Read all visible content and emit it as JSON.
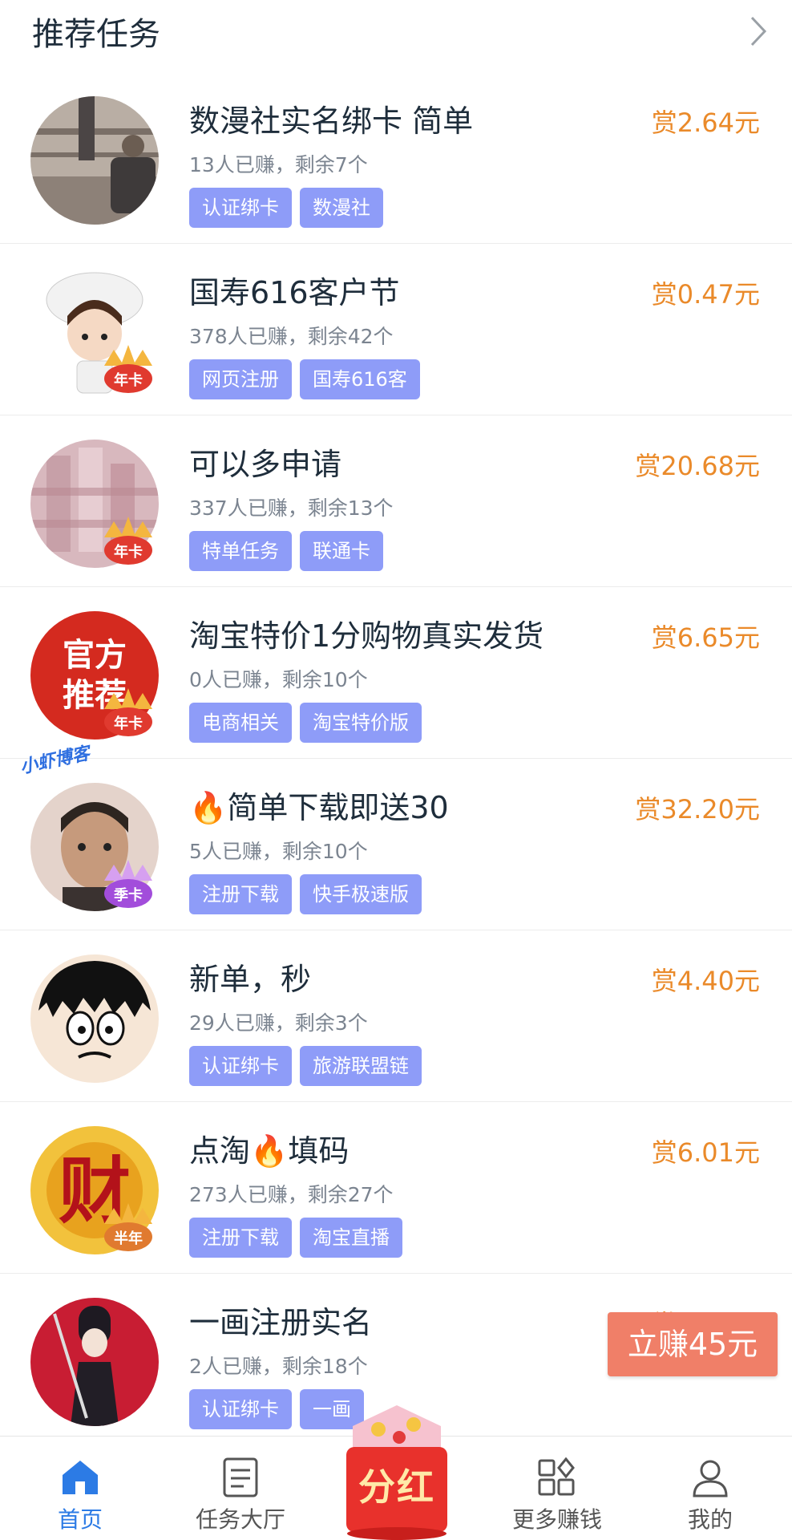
{
  "header": {
    "title": "推荐任务"
  },
  "tasks": [
    {
      "title": "数漫社实名绑卡 简单",
      "stats": "13人已赚，剩余7个",
      "tags": [
        "认证绑卡",
        "数漫社"
      ],
      "reward": "赏2.64元",
      "badge": ""
    },
    {
      "title": "国寿616客户节",
      "stats": "378人已赚，剩余42个",
      "tags": [
        "网页注册",
        "国寿616客"
      ],
      "reward": "赏0.47元",
      "badge": "年卡"
    },
    {
      "title": "可以多申请",
      "stats": "337人已赚，剩余13个",
      "tags": [
        "特单任务",
        "联通卡"
      ],
      "reward": "赏20.68元",
      "badge": "年卡"
    },
    {
      "title": "淘宝特价1分购物真实发货",
      "stats": "0人已赚，剩余10个",
      "tags": [
        "电商相关",
        "淘宝特价版"
      ],
      "reward": "赏6.65元",
      "badge": "年卡",
      "avatar_text": [
        "官方",
        "推荐"
      ]
    },
    {
      "title": "🔥简单下载即送30",
      "stats": "5人已赚，剩余10个",
      "tags": [
        "注册下载",
        "快手极速版"
      ],
      "reward": "赏32.20元",
      "badge": "季卡"
    },
    {
      "title": "新单，秒",
      "stats": "29人已赚，剩余3个",
      "tags": [
        "认证绑卡",
        "旅游联盟链"
      ],
      "reward": "赏4.40元",
      "badge": ""
    },
    {
      "title": "点淘🔥填码",
      "stats": "273人已赚，剩余27个",
      "tags": [
        "注册下载",
        "淘宝直播"
      ],
      "reward": "赏6.01元",
      "badge": "半年",
      "avatar_text": [
        "财"
      ]
    },
    {
      "title": "一画注册实名",
      "stats": "2人已赚，剩余18个",
      "tags": [
        "认证绑卡",
        "一画"
      ],
      "reward": "赏1.76元",
      "badge": ""
    }
  ],
  "watermark": "小虾博客",
  "float_button": "立赚45元",
  "tabbar": {
    "items": [
      {
        "label": "首页",
        "icon": "home-icon"
      },
      {
        "label": "任务大厅",
        "icon": "task-list-icon"
      },
      {
        "label": "更多赚钱",
        "icon": "grid-icon"
      },
      {
        "label": "我的",
        "icon": "user-icon"
      }
    ],
    "center": "分红"
  },
  "colors": {
    "accent": "#2c7be5",
    "reward": "#ea8a2a",
    "tag": "#8e9cf8",
    "float": "#f07f68"
  }
}
